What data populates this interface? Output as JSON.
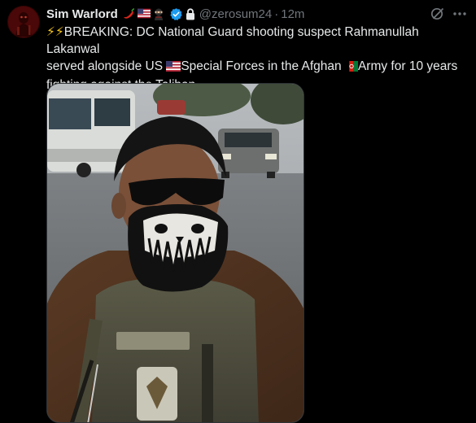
{
  "post": {
    "author_name": "Sim Warlord",
    "author_emojis": [
      "chili-pepper-emoji",
      "us-flag-emoji",
      "ninja-emoji"
    ],
    "handle": "@zerosum24",
    "separator": "·",
    "time": "12m",
    "text_segments": {
      "line1_prefix": "⚡⚡",
      "line1_text": "BREAKING: DC National Guard shooting suspect Rahmanullah Lakanwal",
      "line2_a": "served alongside US ",
      "line2_b": "Special Forces in the Afghan ",
      "line2_c": "Army for 10 years",
      "line3": "fighting against the Taliban."
    },
    "media": {
      "type": "video-thumbnail",
      "subject": "man wearing dark sunglasses, skull face mask and tactical vest on a street"
    }
  },
  "icons": {
    "verified": "verified-badge-icon",
    "lock": "lock-icon",
    "grok": "grok-icon",
    "more": "more-options-icon"
  },
  "colors": {
    "background": "#000000",
    "text_primary": "#e7e9ea",
    "text_secondary": "#71767b",
    "verified_blue": "#1d9bf0",
    "border": "#2f3336"
  }
}
